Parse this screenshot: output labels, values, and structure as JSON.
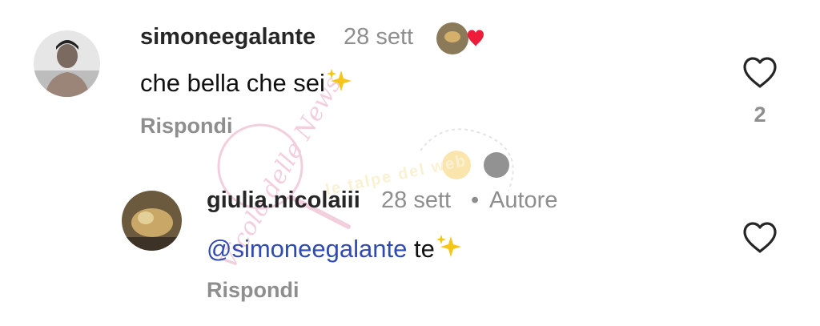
{
  "comments": [
    {
      "username": "simoneegalante",
      "time": "28 sett",
      "text": "che bella che sei",
      "text_emoji": "sparkles",
      "reply_label": "Rispondi",
      "like_count": "2",
      "author_liked": true
    }
  ],
  "replies": [
    {
      "username": "giulia.nicolaiii",
      "time": "28 sett",
      "separator": "•",
      "author_label": "Autore",
      "mention": "@simoneegalante",
      "text": " te",
      "text_emoji": "sparkles",
      "reply_label": "Rispondi"
    }
  ],
  "watermark": {
    "script_text": "Vicolo delle News",
    "banner_text": "le talpe del web"
  },
  "icons": {
    "like": "heart-outline-icon",
    "author_like": "red-heart-icon",
    "emoji": "sparkles-icon"
  },
  "colors": {
    "mention": "#2f4ab3",
    "muted": "#8e8e8e",
    "heart_red": "#ed1c3a"
  }
}
